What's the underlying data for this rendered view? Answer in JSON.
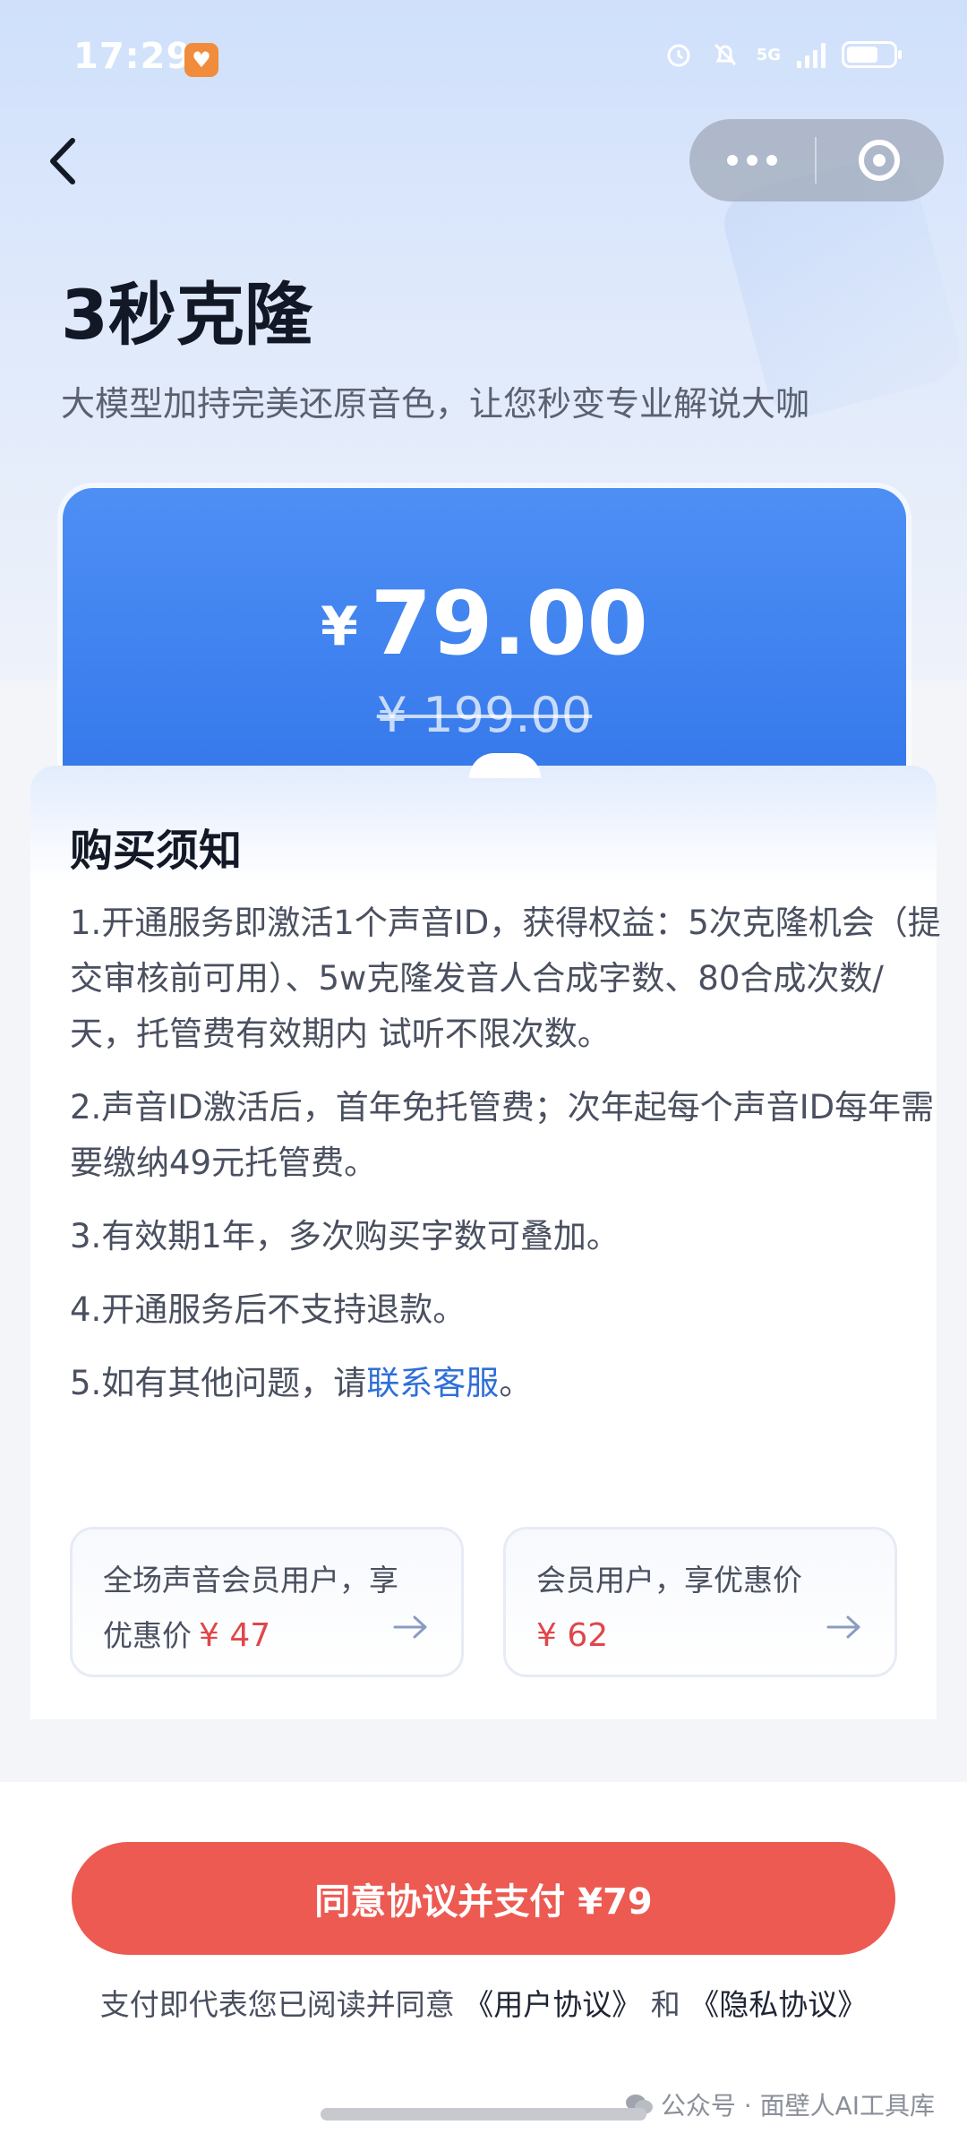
{
  "status_bar": {
    "time": "17:29",
    "network": "5G"
  },
  "nav": {
    "back_icon": "chevron-left-icon",
    "more_icon": "more-dots-icon",
    "close_icon": "target-close-icon"
  },
  "header": {
    "title": "3秒克隆",
    "subtitle": "大模型加持完美还原音色，让您秒变专业解说大咖"
  },
  "price": {
    "currency": "¥",
    "current": "79.00",
    "original": "¥ 199.00"
  },
  "notice": {
    "title": "购买须知",
    "items": [
      "1.开通服务即激活1个声音ID，获得权益：5次克隆机会（提交审核前可用）、5w克隆发音人合成字数、80合成次数/天，托管费有效期内 试听不限次数。",
      "2.声音ID激活后，首年免托管费；次年起每个声音ID每年需要缴纳49元托管费。",
      "3.有效期1年，多次购买字数可叠加。",
      "4.开通服务后不支持退款。"
    ],
    "item5_prefix": "5.如有其他问题，请",
    "item5_link": "联系客服",
    "item5_suffix": "。"
  },
  "member_offers": [
    {
      "text": "全场声音会员用户，享优惠价",
      "price": "¥ 47"
    },
    {
      "text": "会员用户，享优惠价",
      "price": "¥ 62"
    }
  ],
  "footer": {
    "pay_button": "同意协议并支付 ¥79",
    "agreement_prefix": "支付即代表您已阅读并同意",
    "user_agreement": "《用户协议》",
    "and": "和",
    "privacy_agreement": "《隐私协议》",
    "watermark": "公众号 · 面壁人AI工具库"
  },
  "colors": {
    "accent_blue": "#3578ea",
    "pay_red": "#ec5a52",
    "price_red": "#e0464a",
    "link_blue": "#2f6fd9"
  }
}
